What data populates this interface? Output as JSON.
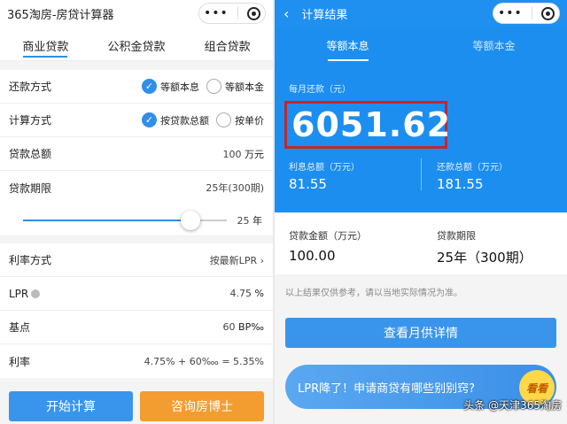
{
  "left": {
    "title": "365淘房-房贷计算器",
    "tabs": [
      "商业贷款",
      "公积金贷款",
      "组合贷款"
    ],
    "repay_method": {
      "label": "还款方式",
      "opt1": "等额本息",
      "opt2": "等额本金"
    },
    "calc_method": {
      "label": "计算方式",
      "opt1": "按贷款总额",
      "opt2": "按单价"
    },
    "loan_total": {
      "label": "贷款总额",
      "value": "100",
      "unit": "万元"
    },
    "loan_term": {
      "label": "贷款期限",
      "value": "25年(300期)",
      "slider_value": "25",
      "slider_unit": "年",
      "slider_fraction": 0.82
    },
    "rate_method": {
      "label": "利率方式",
      "value": "按最新LPR",
      "chevron": "›"
    },
    "lpr": {
      "label": "LPR",
      "value": "4.75",
      "unit": "%"
    },
    "basis": {
      "label": "基点",
      "value": "60",
      "unit": "BP‰"
    },
    "rate": {
      "label": "利率",
      "value": "4.75% + 60‱ = 5.35%"
    },
    "btn_start": "开始计算",
    "btn_consult": "咨询房博士"
  },
  "right": {
    "title": "计算结果",
    "back": "‹",
    "tabs": [
      "等额本息",
      "等额本金"
    ],
    "monthly_label": "每月还款（元）",
    "monthly_value": "6051.62",
    "interest_label": "利息总额（万元）",
    "interest_value": "81.55",
    "repay_label": "还款总额（万元）",
    "repay_value": "181.55",
    "loan_amount_label": "贷款金额（万元）",
    "loan_amount_value": "100.00",
    "loan_term_label": "贷款期限",
    "loan_term_value": "25年（300期）",
    "note": "以上结果仅供参考，请以当地实际情况为准。",
    "detail_btn": "查看月供详情",
    "banner_text": "LPR降了！申请商贷有哪些别别窍?",
    "banner_badge": "看看",
    "watermark": "头条 @天津365淘房"
  },
  "capsule": {
    "dots": "•••"
  },
  "colors": {
    "accent": "#2f8fe9",
    "header_blue": "#1f8ff0",
    "orange": "#f39c2f",
    "highlight": "#c0282c"
  }
}
